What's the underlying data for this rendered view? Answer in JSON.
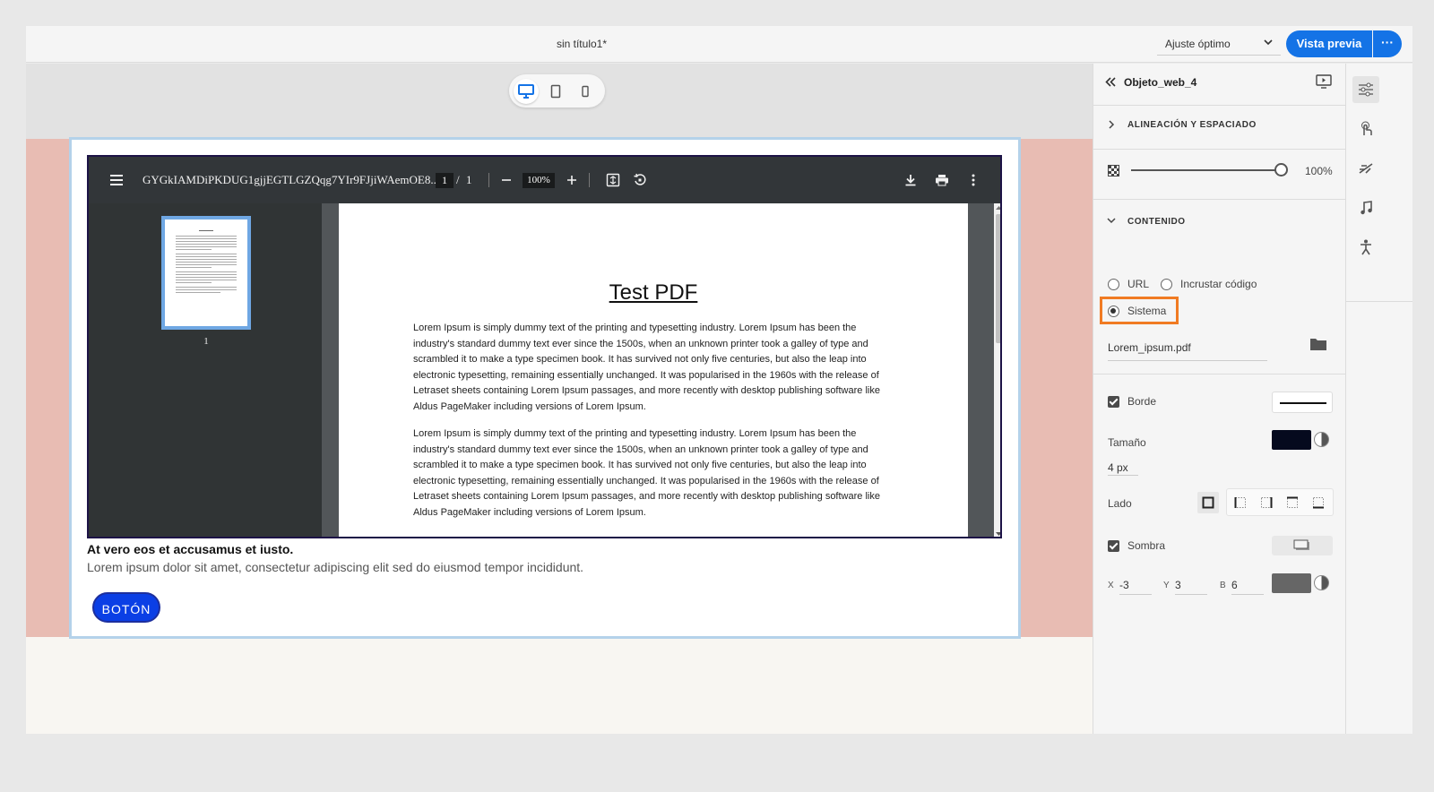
{
  "topbar": {
    "doc_title": "sin título1*",
    "zoom_label": "Ajuste óptimo",
    "preview_label": "Vista previa",
    "more_label": "···"
  },
  "pdf": {
    "filename": "GYGkIAMDiPKDUG1gjjEGTLGZQqg7YIr9FJjiWAemOE8...",
    "page_current": "1",
    "page_sep": "/",
    "page_total": "1",
    "zoom": "100%",
    "thumb_number": "1",
    "page_title": "Test PDF",
    "paragraphs": [
      "Lorem Ipsum is simply dummy text of the printing and typesetting industry. Lorem Ipsum has been the industry's standard dummy text ever since the 1500s, when an unknown printer took a galley of type and scrambled it to make a type specimen book. It has survived not only five centuries, but also the leap into electronic typesetting, remaining essentially unchanged. It was popularised in the 1960s with the release of Letraset sheets containing Lorem Ipsum passages, and more recently with desktop publishing software like Aldus PageMaker including versions of Lorem Ipsum.",
      "Lorem Ipsum is simply dummy text of the printing and typesetting industry. Lorem Ipsum has been the industry's standard dummy text ever since the 1500s, when an unknown printer took a galley of type and scrambled it to make a type specimen book. It has survived not only five centuries, but also the leap into electronic typesetting, remaining essentially unchanged. It was popularised in the 1960s with the release of Letraset sheets containing Lorem Ipsum passages, and more recently with desktop publishing software like Aldus PageMaker including versions of Lorem Ipsum."
    ]
  },
  "content": {
    "heading": "At vero eos et accusamus et iusto.",
    "body": "Lorem ipsum dolor sit amet, consectetur adipiscing elit sed do eiusmod tempor incididunt.",
    "button_label": "BOTÓN"
  },
  "panel": {
    "object_name": "Objeto_web_4",
    "section_alignment": "ALINEACIÓN Y ESPACIADO",
    "opacity_value": "100%",
    "opacity_fraction": 1.0,
    "section_content": "CONTENIDO",
    "radio_url": "URL",
    "radio_embed": "Incrustar código",
    "radio_system": "Sistema",
    "file_name": "Lorem_ipsum.pdf",
    "border_label": "Borde",
    "size_label": "Tamaño",
    "size_value": "4 px",
    "side_label": "Lado",
    "shadow_label": "Sombra",
    "x_label": "X",
    "x_value": "-3",
    "y_label": "Y",
    "y_value": "3",
    "b_label": "B",
    "b_value": "6",
    "border_color": "#050a1e",
    "shadow_color": "#666666"
  },
  "colors": {
    "accent": "#1473e6",
    "section_bg": "#e8bcb3",
    "cta_bg": "#0b3fe5",
    "highlight": "#f07b23"
  }
}
